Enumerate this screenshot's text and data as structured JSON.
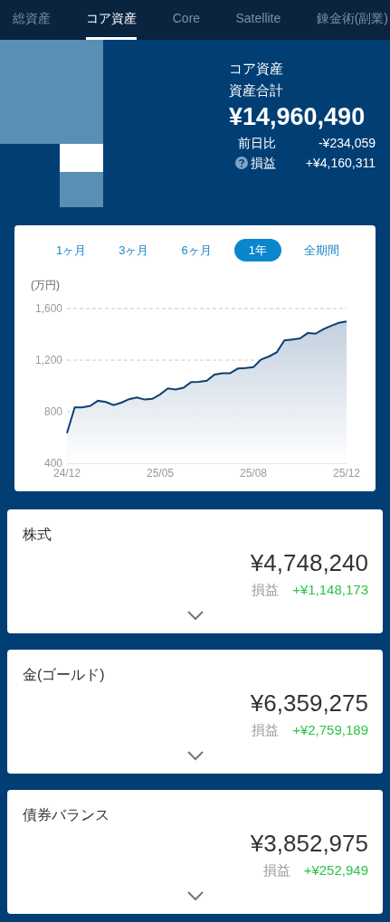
{
  "tabs": [
    {
      "label": "総資産",
      "selected": false
    },
    {
      "label": "コア資産",
      "selected": true
    },
    {
      "label": "Core",
      "selected": false
    },
    {
      "label": "Satellite",
      "selected": false
    },
    {
      "label": "錬金術(副業)",
      "selected": false
    }
  ],
  "summary": {
    "title": "コア資産",
    "subtitle": "資産合計",
    "total": "¥14,960,490",
    "rows": [
      {
        "label": "前日比",
        "value": "-¥234,059",
        "help_icon": false
      },
      {
        "label": "損益",
        "value": "+¥4,160,311",
        "help_icon": true
      }
    ]
  },
  "chart_card": {
    "periods": [
      {
        "label": "1ヶ月",
        "selected": false
      },
      {
        "label": "3ヶ月",
        "selected": false
      },
      {
        "label": "6ヶ月",
        "selected": false
      },
      {
        "label": "1年",
        "selected": true
      },
      {
        "label": "全期間",
        "selected": false
      }
    ],
    "unit": "(万円)",
    "chart_data": {
      "type": "area",
      "categories": [
        "24/12",
        null,
        null,
        null,
        null,
        null,
        null,
        null,
        null,
        null,
        null,
        null,
        "25/05",
        null,
        null,
        null,
        null,
        null,
        null,
        null,
        null,
        null,
        null,
        null,
        "25/08",
        null,
        null,
        null,
        null,
        null,
        null,
        null,
        null,
        null,
        null,
        null,
        "25/12"
      ],
      "series": [
        {
          "color": "#0d3f73",
          "values": [
            633,
            833,
            833,
            845,
            885,
            876,
            852,
            870,
            897,
            911,
            894,
            900,
            935,
            980,
            972,
            985,
            1030,
            1032,
            1040,
            1088,
            1099,
            1099,
            1135,
            1138,
            1145,
            1205,
            1228,
            1260,
            1352,
            1360,
            1368,
            1410,
            1405,
            1440,
            1466,
            1490,
            1500
          ]
        }
      ],
      "ylim": [
        400,
        1600
      ],
      "yticks": [
        {
          "value": 400,
          "label": "400"
        },
        {
          "value": 800,
          "label": "800"
        },
        {
          "value": 1200,
          "label": "1,200"
        },
        {
          "value": 1600,
          "label": "1,600"
        }
      ]
    }
  },
  "categories": [
    {
      "name": "株式",
      "amount": "¥4,748,240",
      "profit_label": "損益",
      "profit": "+¥1,148,173"
    },
    {
      "name": "金(ゴールド)",
      "amount": "¥6,359,275",
      "profit_label": "損益",
      "profit": "+¥2,759,189"
    },
    {
      "name": "債券バランス",
      "amount": "¥3,852,975",
      "profit_label": "損益",
      "profit": "+¥252,949"
    }
  ]
}
